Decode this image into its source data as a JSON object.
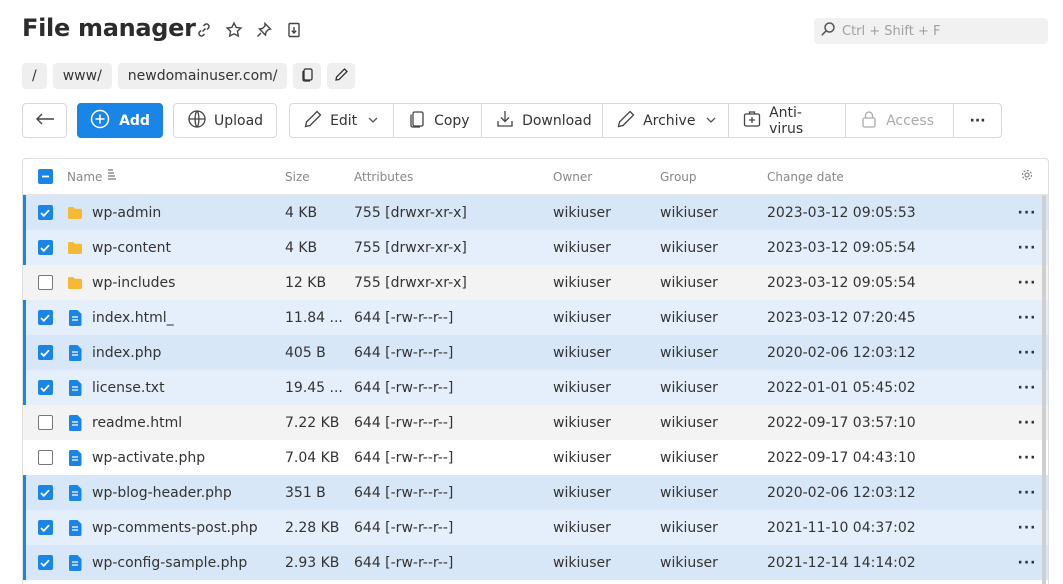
{
  "page": {
    "title": "File manager",
    "search_placeholder": "Ctrl + Shift + F"
  },
  "breadcrumbs": [
    "/",
    "www/",
    "newdomainuser.com/"
  ],
  "toolbar": {
    "add": "Add",
    "upload": "Upload",
    "edit": "Edit",
    "copy": "Copy",
    "download": "Download",
    "archive": "Archive",
    "antivirus": "Anti-virus",
    "access": "Access",
    "more": "···"
  },
  "columns": {
    "name": "Name",
    "size": "Size",
    "attributes": "Attributes",
    "owner": "Owner",
    "group": "Group",
    "change_date": "Change date"
  },
  "rows": [
    {
      "type": "folder",
      "selected": true,
      "name": "wp-admin",
      "size": "4 KB",
      "attributes": "755 [drwxr-xr-x]",
      "owner": "wikiuser",
      "group": "wikiuser",
      "date": "2023-03-12 09:05:53"
    },
    {
      "type": "folder",
      "selected": true,
      "name": "wp-content",
      "size": "4 KB",
      "attributes": "755 [drwxr-xr-x]",
      "owner": "wikiuser",
      "group": "wikiuser",
      "date": "2023-03-12 09:05:54"
    },
    {
      "type": "folder",
      "selected": false,
      "name": "wp-includes",
      "size": "12 KB",
      "attributes": "755 [drwxr-xr-x]",
      "owner": "wikiuser",
      "group": "wikiuser",
      "date": "2023-03-12 09:05:54"
    },
    {
      "type": "file",
      "selected": true,
      "name": "index.html_",
      "size": "11.84 ...",
      "attributes": "644 [-rw-r--r--]",
      "owner": "wikiuser",
      "group": "wikiuser",
      "date": "2023-03-12 07:20:45"
    },
    {
      "type": "file",
      "selected": true,
      "name": "index.php",
      "size": "405 B",
      "attributes": "644 [-rw-r--r--]",
      "owner": "wikiuser",
      "group": "wikiuser",
      "date": "2020-02-06 12:03:12"
    },
    {
      "type": "file",
      "selected": true,
      "name": "license.txt",
      "size": "19.45 ...",
      "attributes": "644 [-rw-r--r--]",
      "owner": "wikiuser",
      "group": "wikiuser",
      "date": "2022-01-01 05:45:02"
    },
    {
      "type": "file",
      "selected": false,
      "name": "readme.html",
      "size": "7.22 KB",
      "attributes": "644 [-rw-r--r--]",
      "owner": "wikiuser",
      "group": "wikiuser",
      "date": "2022-09-17 03:57:10"
    },
    {
      "type": "file",
      "selected": false,
      "name": "wp-activate.php",
      "size": "7.04 KB",
      "attributes": "644 [-rw-r--r--]",
      "owner": "wikiuser",
      "group": "wikiuser",
      "date": "2022-09-17 04:43:10"
    },
    {
      "type": "file",
      "selected": true,
      "name": "wp-blog-header.php",
      "size": "351 B",
      "attributes": "644 [-rw-r--r--]",
      "owner": "wikiuser",
      "group": "wikiuser",
      "date": "2020-02-06 12:03:12"
    },
    {
      "type": "file",
      "selected": true,
      "name": "wp-comments-post.php",
      "size": "2.28 KB",
      "attributes": "644 [-rw-r--r--]",
      "owner": "wikiuser",
      "group": "wikiuser",
      "date": "2021-11-10 04:37:02"
    },
    {
      "type": "file",
      "selected": true,
      "name": "wp-config-sample.php",
      "size": "2.93 KB",
      "attributes": "644 [-rw-r--r--]",
      "owner": "wikiuser",
      "group": "wikiuser",
      "date": "2021-12-14 14:14:02"
    }
  ],
  "colors": {
    "accent": "#1a85e6",
    "folder": "#f5b935",
    "file": "#1a85e6"
  }
}
